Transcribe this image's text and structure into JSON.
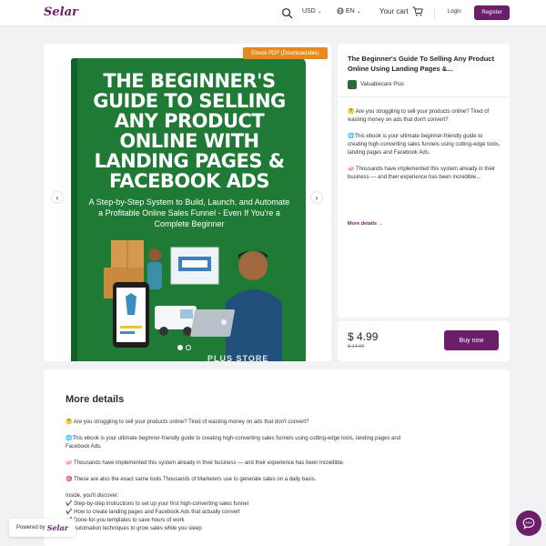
{
  "header": {
    "logo": "Selar",
    "currency": "USD",
    "language": "EN",
    "cart_label": "Your cart",
    "login_label": "Login",
    "register_label": "Register"
  },
  "gallery": {
    "badge": "Ebook PDF (Downloadable)",
    "book_title": "THE BEGINNER'S GUIDE TO SELLING ANY PRODUCT ONLINE WITH LANDING PAGES & FACEBOOK ADS",
    "book_subtitle": "A Step-by-Step System to Build, Launch, and Automate a Profitable Online Sales Funnel - Even If You're a Complete Beginner",
    "book_footer": "PLUS STORE",
    "slides_total": 2,
    "slide_active": 1
  },
  "product": {
    "title": "The Beginner's Guide To Selling Any Product Online Using Landing Pages &...",
    "seller": "Valuablecare Plus",
    "desc": [
      "🤔 Are you struggling to sell your products online? Tired of wasting money on ads that don't convert?",
      "🌐This ebook is your ultimate beginner-friendly guide to creating high-converting sales funnels using cutting-edge tools, landing pages and Facebook Ads.",
      "🧼 Thousands have implemented this system already in their business — and their experience has been incredible..."
    ],
    "more_link": "More details →",
    "price": "$ 4.99",
    "old_price": "$ 14.99",
    "buy_label": "Buy now"
  },
  "details": {
    "title": "More details",
    "paragraphs": [
      "🤔 Are you struggling to sell your products online? Tired of wasting money on ads that don't convert?",
      "🌐This ebook is your ultimate beginner-friendly guide to creating high-converting sales funnels using cutting-edge tools, landing pages and Facebook Ads.",
      "🧼 Thousands have implemented this system already in their business — and their experience has been incredible.",
      "🎯 These are also the exact same tools Thousands of Marketers use to generate sales on a daily basis."
    ],
    "list_intro": "Inside, you'll discover:",
    "list": [
      "✔️ Step-by-step instructions to set up your first high-converting sales funnel",
      "✔️ How to create landing pages and Facebook Ads that actually convert",
      "✔️ Done-for-you templates to save hours of work",
      "✔️ Automation techniques to grow sales while you sleep"
    ]
  },
  "footer": {
    "powered_label": "Powered by",
    "powered_logo": "Selar"
  },
  "colors": {
    "brand": "#6b1f6b",
    "badge": "#e58a1f",
    "book": "#1f7a35"
  }
}
